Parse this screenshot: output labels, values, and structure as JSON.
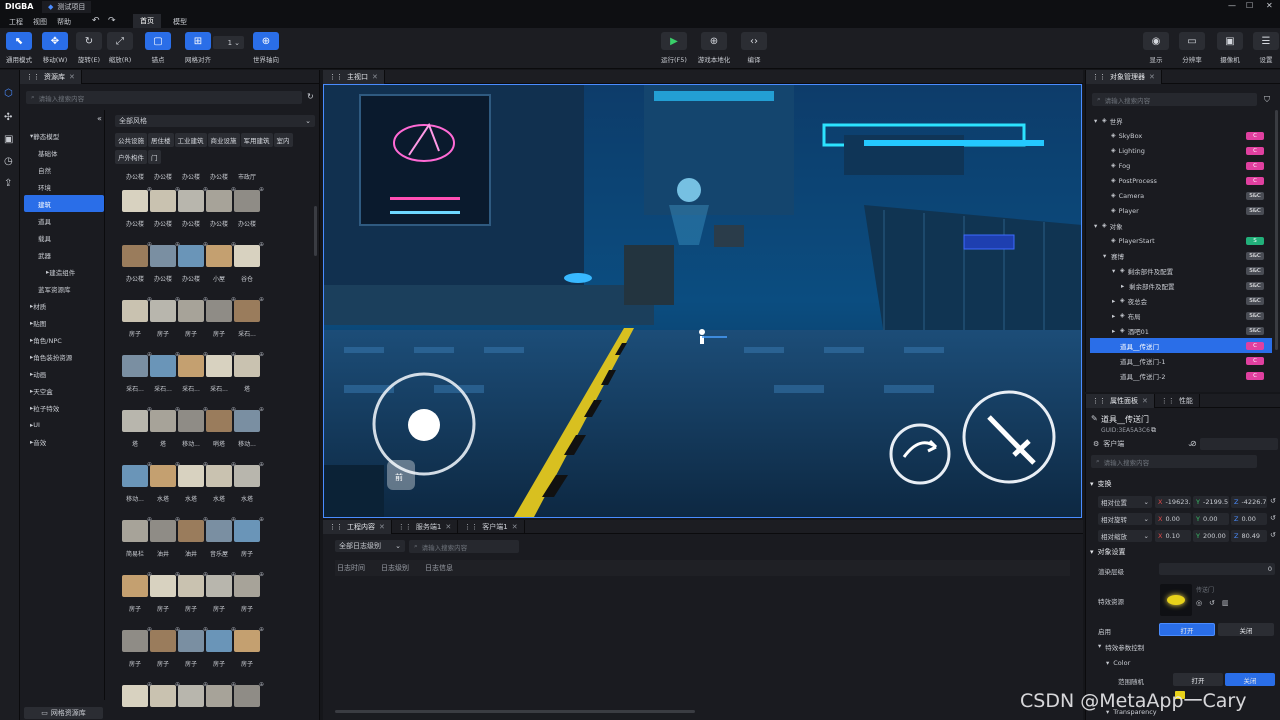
{
  "app": {
    "logo": "DIGBA",
    "project_tab": "测试项目",
    "win_min": "—",
    "win_max": "☐",
    "win_close": "✕"
  },
  "menu": {
    "items": [
      "工程",
      "视图",
      "帮助"
    ],
    "undo": "↶",
    "redo": "↷",
    "tabs": [
      "首页",
      "模型"
    ],
    "active_tab": 0
  },
  "toolbar": {
    "left": [
      {
        "label": "通用模式",
        "icon": "cursor-icon",
        "glyph": "⬉",
        "active": true
      },
      {
        "label": "移动(W)",
        "icon": "move-icon",
        "glyph": "✥",
        "active": true
      },
      {
        "label": "旋转(E)",
        "icon": "rotate-icon",
        "glyph": "↻",
        "active": false
      },
      {
        "label": "缩放(R)",
        "icon": "scale-icon",
        "glyph": "⤢",
        "active": false
      },
      {
        "label": "锚点",
        "icon": "anchor-icon",
        "glyph": "▢",
        "active": true
      },
      {
        "label": "网格对齐",
        "icon": "grid-icon",
        "glyph": "⊞",
        "active": true
      },
      {
        "label": "世界轴向",
        "icon": "world-axis-icon",
        "glyph": "⊕",
        "active": true
      }
    ],
    "grid_value": "1",
    "center": [
      {
        "label": "运行(F5)",
        "icon": "play-icon",
        "glyph": "▶"
      },
      {
        "label": "游戏本地化",
        "icon": "globe-icon",
        "glyph": "⊕"
      },
      {
        "label": "编译",
        "icon": "code-icon",
        "glyph": "‹›"
      }
    ],
    "right": [
      {
        "label": "显示",
        "icon": "eye-icon",
        "glyph": "◉"
      },
      {
        "label": "分辨率",
        "icon": "monitor-icon",
        "glyph": "▭"
      },
      {
        "label": "摄像机",
        "icon": "camera-icon",
        "glyph": "▣"
      },
      {
        "label": "设置",
        "icon": "settings-icon",
        "glyph": "☰"
      }
    ]
  },
  "assets_panel": {
    "tab": "资源库",
    "search_placeholder": "请输入搜索内容",
    "tree": [
      {
        "label": "静态模型",
        "expanded": true,
        "indent": 0
      },
      {
        "label": "基础体",
        "indent": 1
      },
      {
        "label": "自然",
        "indent": 1
      },
      {
        "label": "环境",
        "indent": 1
      },
      {
        "label": "建筑",
        "indent": 1,
        "selected": true
      },
      {
        "label": "道具",
        "indent": 1
      },
      {
        "label": "载具",
        "indent": 1
      },
      {
        "label": "武器",
        "indent": 1
      },
      {
        "label": "建造组件",
        "indent": 2,
        "arrow": true
      },
      {
        "label": "蓝军资源库",
        "indent": 1
      },
      {
        "label": "材质",
        "indent": 0,
        "arrow": true
      },
      {
        "label": "贴图",
        "indent": 0,
        "arrow": true
      },
      {
        "label": "角色/NPC",
        "indent": 0,
        "arrow": true
      },
      {
        "label": "角色装扮资源",
        "indent": 0,
        "arrow": true
      },
      {
        "label": "动画",
        "indent": 0,
        "arrow": true
      },
      {
        "label": "天空盒",
        "indent": 0,
        "arrow": true
      },
      {
        "label": "粒子特效",
        "indent": 0,
        "arrow": true
      },
      {
        "label": "UI",
        "indent": 0,
        "arrow": true
      },
      {
        "label": "音效",
        "indent": 0,
        "arrow": true
      }
    ],
    "style_select": "全部风格",
    "filters": [
      "公共设施",
      "居住楼",
      "工业建筑",
      "商业设施",
      "军用建筑",
      "室内",
      "户外构件",
      "门"
    ],
    "top_labels": [
      "办公楼",
      "办公楼",
      "办公楼",
      "办公楼",
      "市政厅"
    ],
    "rows": [
      [
        "办公楼",
        "办公楼",
        "办公楼",
        "办公楼",
        "办公楼"
      ],
      [
        "办公楼",
        "办公楼",
        "办公楼",
        "小屋",
        "谷仓"
      ],
      [
        "房子",
        "房子",
        "房子",
        "房子",
        "采石..."
      ],
      [
        "采石...",
        "采石...",
        "采石...",
        "采石...",
        "塔"
      ],
      [
        "塔",
        "塔",
        "移动...",
        "哨塔",
        "移动..."
      ],
      [
        "移动...",
        "水塔",
        "水塔",
        "水塔",
        "水塔"
      ],
      [
        "简易栏",
        "油井",
        "油井",
        "音乐屋",
        "房子"
      ],
      [
        "房子",
        "房子",
        "房子",
        "房子",
        "房子"
      ],
      [
        "房子",
        "房子",
        "房子",
        "房子",
        "房子"
      ],
      [
        "",
        "",
        "",
        "",
        ""
      ]
    ],
    "bottom_button": "网格资源库"
  },
  "viewport": {
    "tab": "主视口",
    "move_label": "前"
  },
  "log_panel": {
    "tabs": [
      "工程内容",
      "服务端1",
      "客户端1"
    ],
    "level_select": "全部日志级别",
    "search_placeholder": "请输入搜索内容",
    "columns": [
      "日志时间",
      "日志级别",
      "日志信息"
    ]
  },
  "objects_panel": {
    "tab": "对象管理器",
    "search_placeholder": "请输入搜索内容",
    "rows": [
      {
        "label": "世界",
        "indent": 0,
        "arrow": "▾",
        "icon": "world-icon",
        "badge": ""
      },
      {
        "label": "SkyBox",
        "indent": 1,
        "icon": "sky-icon",
        "badge": "C",
        "color": "#e040a0"
      },
      {
        "label": "Lighting",
        "indent": 1,
        "icon": "light-icon",
        "badge": "C",
        "color": "#e040a0"
      },
      {
        "label": "Fog",
        "indent": 1,
        "icon": "fog-icon",
        "badge": "C",
        "color": "#e040a0"
      },
      {
        "label": "PostProcess",
        "indent": 1,
        "icon": "post-icon",
        "badge": "C",
        "color": "#e040a0"
      },
      {
        "label": "Camera",
        "indent": 1,
        "icon": "camera-icon",
        "badge": "S&C",
        "color": "#4a4d55"
      },
      {
        "label": "Player",
        "indent": 1,
        "icon": "player-icon",
        "badge": "S&C",
        "color": "#4a4d55"
      },
      {
        "label": "对象",
        "indent": 0,
        "arrow": "▾",
        "icon": "object-icon",
        "badge": ""
      },
      {
        "label": "PlayerStart",
        "indent": 1,
        "icon": "flag-icon",
        "badge": "S",
        "color": "#22b07a"
      },
      {
        "label": "赛博",
        "indent": 1,
        "arrow": "▾",
        "icon": "",
        "badge": "S&C",
        "color": "#4a4d55"
      },
      {
        "label": "剩余部件及配置",
        "indent": 2,
        "arrow": "▾",
        "icon": "group-icon",
        "badge": "S&C",
        "color": "#4a4d55"
      },
      {
        "label": "剩余部件及配置",
        "indent": 3,
        "arrow": "▸",
        "icon": "",
        "badge": "S&C",
        "color": "#4a4d55"
      },
      {
        "label": "夜总会",
        "indent": 2,
        "arrow": "▸",
        "icon": "group-icon",
        "badge": "S&C",
        "color": "#4a4d55"
      },
      {
        "label": "布局",
        "indent": 2,
        "arrow": "▸",
        "icon": "group-icon",
        "badge": "S&C",
        "color": "#4a4d55"
      },
      {
        "label": "酒吧01",
        "indent": 2,
        "arrow": "▸",
        "icon": "group-icon",
        "badge": "S&C",
        "color": "#4a4d55"
      },
      {
        "label": "道具__传送门",
        "indent": 2,
        "icon": "",
        "badge": "C",
        "color": "#e040a0",
        "selected": true
      },
      {
        "label": "道具__传送门-1",
        "indent": 2,
        "icon": "",
        "badge": "C",
        "color": "#e040a0"
      },
      {
        "label": "道具__传送门-2",
        "indent": 2,
        "icon": "",
        "badge": "C",
        "color": "#e040a0"
      }
    ]
  },
  "props_panel": {
    "tabs": [
      "属性面板",
      "性能"
    ],
    "name": "道具__传送门",
    "guid": "GUID:3EA5A3C6",
    "client_select": "客户端",
    "search_placeholder": "请输入搜索内容",
    "transform_title": "变换",
    "transform": [
      {
        "label": "相对位置",
        "x": "-19623.",
        "y": "-2199.5",
        "z": "-4226.7"
      },
      {
        "label": "相对旋转",
        "x": "0.00",
        "y": "0.00",
        "z": "0.00"
      },
      {
        "label": "相对缩放",
        "x": "0.10",
        "y": "200.00",
        "z": "80.49"
      }
    ],
    "object_title": "对象设置",
    "render_layer_label": "渲染层级",
    "render_layer_value": "0",
    "effect_label": "特效资源",
    "effect_name": "传送门",
    "enable_label": "启用",
    "enable_on": "打开",
    "enable_off": "关闭",
    "fx_control": "特效参数控制",
    "color_label": "Color",
    "range_random": "范围随机",
    "range_on": "打开",
    "range_off": "关闭",
    "transparency": "Transparency"
  },
  "watermark": "CSDN @MetaApp一Cary"
}
